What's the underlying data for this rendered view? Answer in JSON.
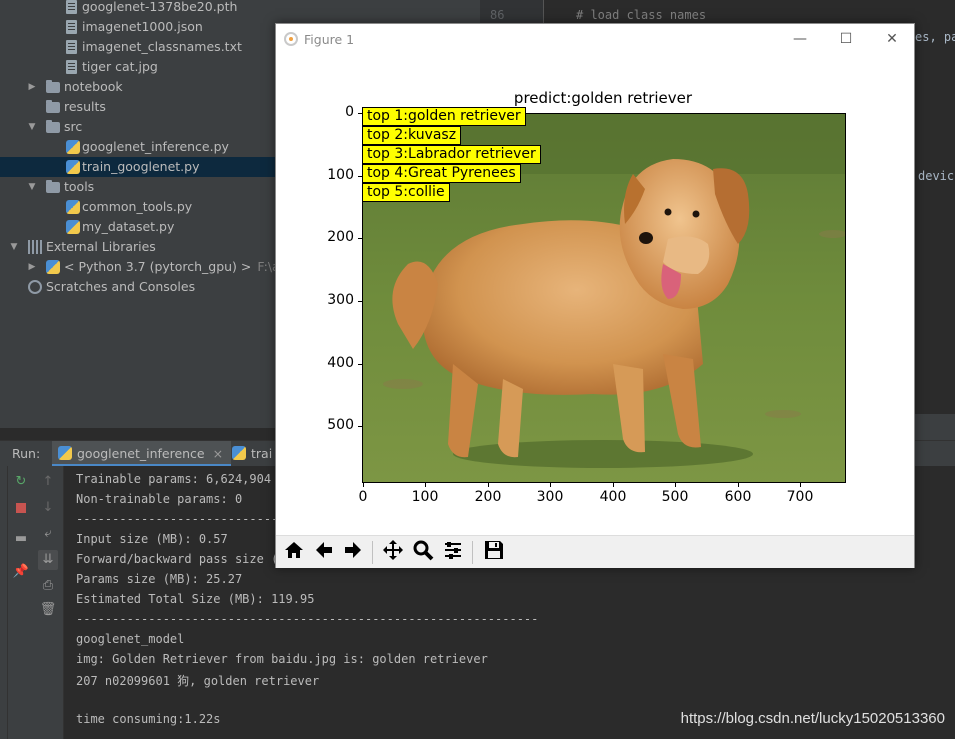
{
  "project_tree": {
    "items": [
      {
        "label": "googlenet-1378be20.pth",
        "icon": "file-icon"
      },
      {
        "label": "imagenet1000.json",
        "icon": "file-icon"
      },
      {
        "label": "imagenet_classnames.txt",
        "icon": "file-icon"
      },
      {
        "label": "tiger cat.jpg",
        "icon": "file-icon"
      },
      {
        "label": "notebook",
        "icon": "folder-icon"
      },
      {
        "label": "results",
        "icon": "folder-icon"
      },
      {
        "label": "src",
        "icon": "folder-icon"
      },
      {
        "label": "googlenet_inference.py",
        "icon": "python-file-icon"
      },
      {
        "label": "train_googlenet.py",
        "icon": "python-file-icon"
      },
      {
        "label": "tools",
        "icon": "folder-icon"
      },
      {
        "label": "common_tools.py",
        "icon": "python-file-icon"
      },
      {
        "label": "my_dataset.py",
        "icon": "python-file-icon"
      },
      {
        "label": "External Libraries",
        "icon": "library-icon"
      },
      {
        "label": "< Python 3.7 (pytorch_gpu) >",
        "extra": "F:\\ana",
        "icon": "python-icon"
      },
      {
        "label": "Scratches and Consoles",
        "icon": "scratches-icon"
      }
    ]
  },
  "editor": {
    "line_number": "86",
    "comment": "# load class names",
    "fragment_1": "es, pa",
    "fragment_2": "devic"
  },
  "run_panel": {
    "label": "Run:",
    "tabs": [
      {
        "label": "googlenet_inference"
      },
      {
        "label": "trai"
      }
    ],
    "console_lines": [
      "Trainable params: 6,624,904",
      "Non-trainable params: 0",
      "------------------------------",
      "Input size (MB): 0.57",
      "Forward/backward pass size (",
      "Params size (MB): 25.27",
      "Estimated Total Size (MB): 119.95",
      "----------------------------------------------------------------",
      "googlenet_model",
      "img: Golden Retriever from baidu.jpg is: golden retriever",
      "207 n02099601 狗, golden retriever",
      "",
      "time consuming:1.22s"
    ]
  },
  "watermark": "https://blog.csdn.net/lucky15020513360",
  "figure": {
    "window_title": "Figure 1",
    "plot_title": "predict:golden retriever",
    "labels": [
      "top 1:golden retriever",
      "top 2:kuvasz",
      "top 3:Labrador retriever",
      "top 4:Great Pyrenees",
      "top 5:collie"
    ],
    "y_ticks": [
      "0",
      "100",
      "200",
      "300",
      "400",
      "500"
    ],
    "x_ticks": [
      "0",
      "100",
      "200",
      "300",
      "400",
      "500",
      "600",
      "700"
    ],
    "toolbar": [
      "home-icon",
      "back-icon",
      "forward-icon",
      "pan-icon",
      "zoom-icon",
      "configure-icon",
      "save-icon"
    ],
    "label_color": "#ffff00"
  }
}
